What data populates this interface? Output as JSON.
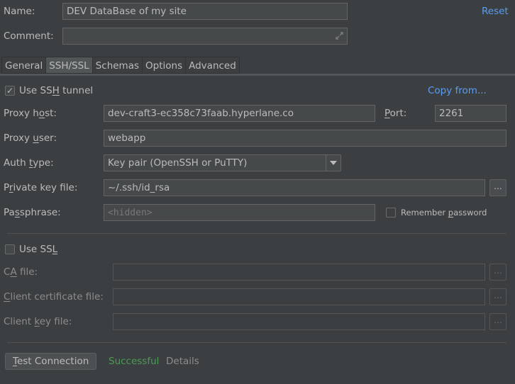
{
  "header": {
    "name_label": "Name:",
    "name_value": "DEV DataBase of my site",
    "comment_label": "Comment:",
    "comment_value": "",
    "reset_link": "Reset",
    "expand_icon": "expand-icon"
  },
  "tabs": [
    {
      "label": "General",
      "active": false
    },
    {
      "label": "SSH/SSL",
      "active": true
    },
    {
      "label": "Schemas",
      "active": false
    },
    {
      "label": "Options",
      "active": false
    },
    {
      "label": "Advanced",
      "active": false
    }
  ],
  "ssh": {
    "use_ssh_tunnel": {
      "pre": "Use SS",
      "mnemonic": "H",
      "post": " tunnel",
      "checked": true
    },
    "copy_from": "Copy from...",
    "proxy_host": {
      "pre": "Proxy h",
      "mnemonic": "o",
      "post": "st:",
      "value": "dev-craft3-ec358c73faab.hyperlane.co"
    },
    "port": {
      "pre": "",
      "mnemonic": "P",
      "post": "ort:",
      "value": "2261"
    },
    "proxy_user": {
      "pre": "Proxy ",
      "mnemonic": "u",
      "post": "ser:",
      "value": "webapp"
    },
    "auth_type": {
      "pre": "Auth ",
      "mnemonic": "t",
      "post": "ype:",
      "value": "Key pair (OpenSSH or PuTTY)"
    },
    "private_key_file": {
      "pre": "P",
      "mnemonic": "r",
      "post": "ivate key file:",
      "value": "~/.ssh/id_rsa",
      "browse": "..."
    },
    "passphrase": {
      "pre": "Pa",
      "mnemonic": "s",
      "post": "sphrase:",
      "placeholder": "<hidden>"
    },
    "remember_password": {
      "pre": "Remember ",
      "mnemonic": "p",
      "post": "assword",
      "checked": false
    }
  },
  "ssl": {
    "use_ssl": {
      "pre": "Use SS",
      "mnemonic": "L",
      "post": "",
      "checked": false
    },
    "ca_file": {
      "pre": "C",
      "mnemonic": "A",
      "post": " file:",
      "value": "",
      "browse": "..."
    },
    "client_cert_file": {
      "pre": "",
      "mnemonic": "C",
      "post": "lient certificate file:",
      "value": "",
      "browse": "..."
    },
    "client_key_file": {
      "pre": "Client ",
      "mnemonic": "k",
      "post": "ey file:",
      "value": "",
      "browse": "..."
    }
  },
  "footer": {
    "test_connection": {
      "pre": "",
      "mnemonic": "T",
      "post": "est Connection"
    },
    "status": "Successful",
    "status_color": "#499c54",
    "details": "Details"
  }
}
